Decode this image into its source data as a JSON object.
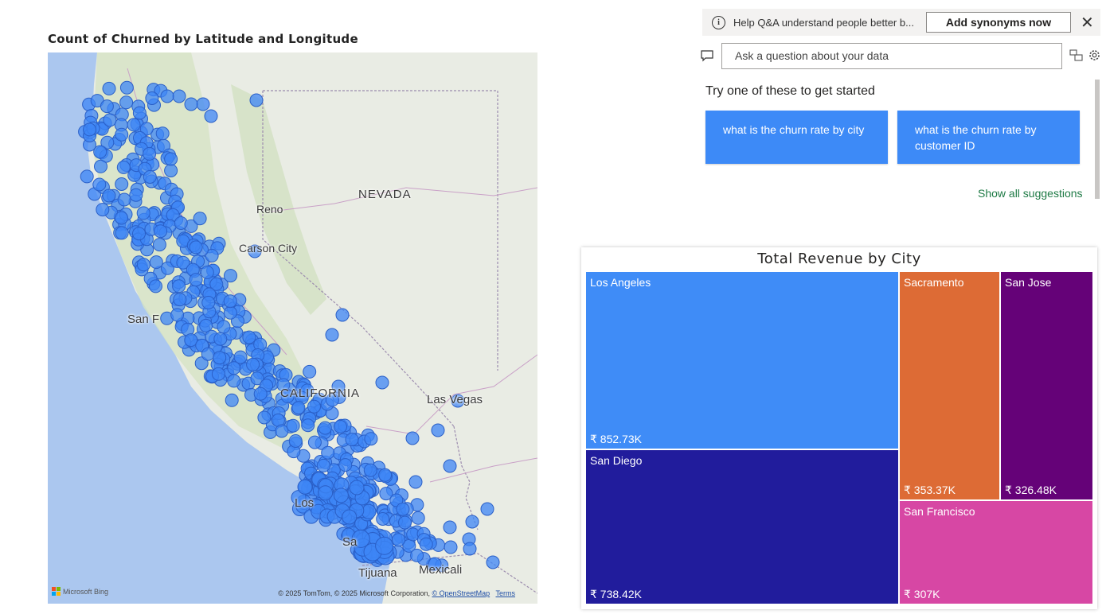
{
  "map": {
    "title": "Count of Churned by Latitude and Longitude",
    "labels": {
      "nevada": "NEVADA",
      "reno": "Reno",
      "carson_city": "Carson City",
      "san_francisco": "San F",
      "california": "CALIFORNIA",
      "las_vegas": "Las Vegas",
      "los_angeles": "Los",
      "san_diego": "Sa",
      "tijuana": "Tijuana",
      "mexicali": "Mexicali"
    },
    "bing_label": "Microsoft Bing",
    "attribution": "© 2025 TomTom, © 2025 Microsoft Corporation,",
    "osm_link": "© OpenStreetMap",
    "terms_link": "Terms",
    "bubble_color": "#3d86f5",
    "bubble_stroke": "#2a5fc7"
  },
  "qa": {
    "banner_text": "Help Q&A understand people better b...",
    "add_synonyms_label": "Add synonyms now",
    "input_placeholder": "Ask a question about your data",
    "try_title": "Try one of these to get started",
    "suggestions": [
      {
        "text": "what is the churn rate by city"
      },
      {
        "text": "what is the churn rate by customer ID"
      }
    ],
    "show_all_label": "Show all suggestions",
    "accent_color": "#3d8af7"
  },
  "treemap": {
    "title": "Total Revenue by City",
    "chart_data": {
      "type": "treemap",
      "title": "Total Revenue by City",
      "currency": "₹",
      "items": [
        {
          "city": "Los Angeles",
          "value": 852.73,
          "label": "₹ 852.73K",
          "color": "#3f8cf7"
        },
        {
          "city": "San Diego",
          "value": 738.42,
          "label": "₹ 738.42K",
          "color": "#211c9c"
        },
        {
          "city": "Sacramento",
          "value": 353.37,
          "label": "₹ 353.37K",
          "color": "#dd6b35"
        },
        {
          "city": "San Jose",
          "value": 326.48,
          "label": "₹ 326.48K",
          "color": "#650278"
        },
        {
          "city": "San Francisco",
          "value": 307,
          "label": "₹ 307K",
          "color": "#d747a4"
        }
      ]
    }
  }
}
